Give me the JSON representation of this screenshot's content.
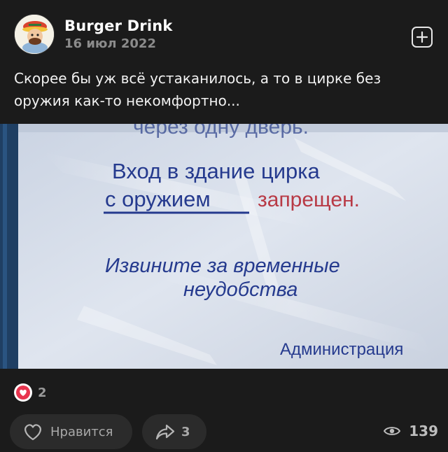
{
  "author": {
    "name": "Burger Drink",
    "date": "16 июл 2022"
  },
  "post": {
    "text": "Скорее бы уж всё устаканилось, а то в цирке без оружия как-то некомфортно..."
  },
  "image": {
    "sign_top": "через одну дверь.",
    "sign_line1": "Вход в здание цирка",
    "sign_line2_underlined": "с оружием",
    "sign_line2_red": "запрещен.",
    "sign_line3": "Извините за временные",
    "sign_line4": "неудобства",
    "sign_signature": "Администрация"
  },
  "reactions": {
    "icon": "heart-icon",
    "count": "2"
  },
  "actions": {
    "like_label": "Нравится",
    "share_count": "3",
    "views_count": "139"
  },
  "colors": {
    "heart": "#e8344e",
    "background": "#1b1b1b",
    "button_bg": "#2b2b2b"
  }
}
